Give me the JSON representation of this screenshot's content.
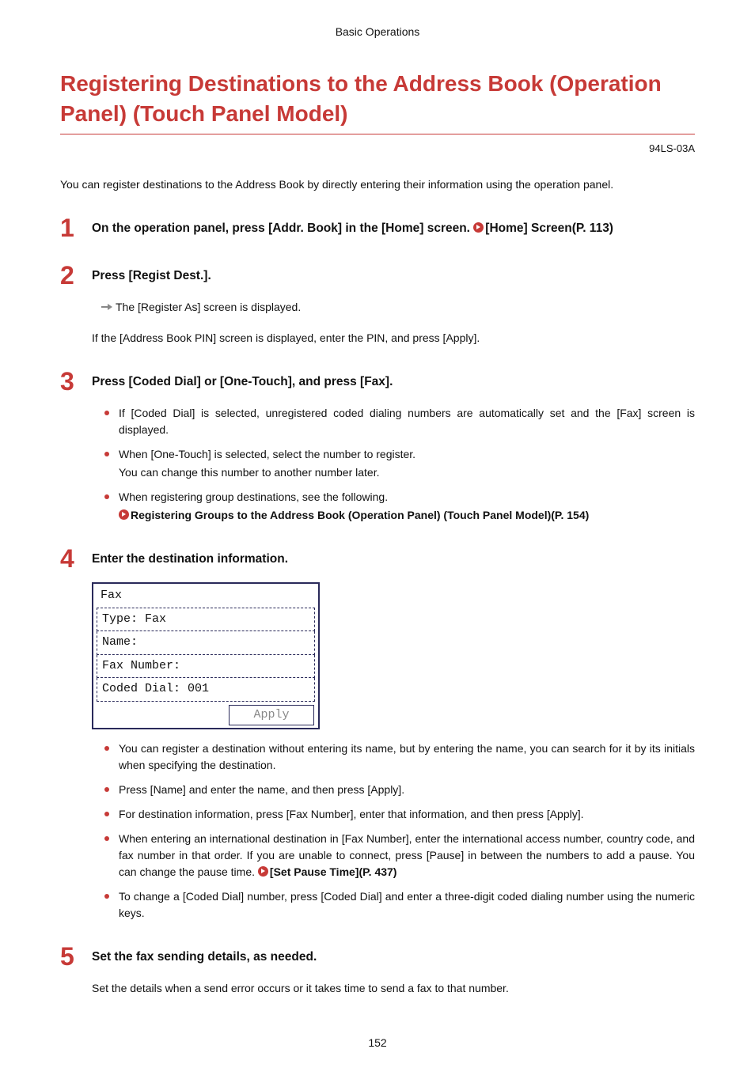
{
  "header": {
    "section": "Basic Operations"
  },
  "title": "Registering Destinations to the Address Book (Operation Panel) (Touch Panel Model)",
  "doc_code": "94LS-03A",
  "intro": "You can register destinations to the Address Book by directly entering their information using the operation panel.",
  "steps": {
    "s1": {
      "num": "1",
      "title_a": "On the operation panel, press [Addr. Book] in the [Home] screen. ",
      "link": "[Home] Screen(P. 113)"
    },
    "s2": {
      "num": "2",
      "title": "Press [Regist Dest.].",
      "result": "The [Register As] screen is displayed.",
      "note": "If the [Address Book PIN] screen is displayed, enter the PIN, and press [Apply]."
    },
    "s3": {
      "num": "3",
      "title": "Press [Coded Dial] or [One-Touch], and press [Fax].",
      "b1": "If [Coded Dial] is selected, unregistered coded dialing numbers are automatically set and the [Fax] screen is displayed.",
      "b2a": "When [One-Touch] is selected, select the number to register.",
      "b2b": "You can change this number to another number later.",
      "b3a": "When registering group destinations, see the following.",
      "b3link": "Registering Groups to the Address Book (Operation Panel) (Touch Panel Model)(P. 154)"
    },
    "s4": {
      "num": "4",
      "title": "Enter the destination information.",
      "screen": {
        "title": "Fax",
        "row1": "Type: Fax",
        "row2": "Name:",
        "row3": "Fax Number:",
        "row4": "Coded Dial: 001",
        "apply": "Apply"
      },
      "b1": "You can register a destination without entering its name, but by entering the name, you can search for it by its initials when specifying the destination.",
      "b2": "Press [Name] and enter the name, and then press [Apply].",
      "b3": "For destination information, press [Fax Number], enter that information, and then press [Apply].",
      "b4a": "When entering an international destination in [Fax Number], enter the international access number, country code, and fax number in that order. If you are unable to connect, press [Pause] in between the numbers to add a pause. You can change the pause time. ",
      "b4link": "[Set Pause Time](P. 437)",
      "b5": "To change a [Coded Dial] number, press [Coded Dial] and enter a three-digit coded dialing number using the numeric keys."
    },
    "s5": {
      "num": "5",
      "title": "Set the fax sending details, as needed.",
      "p": "Set the details when a send error occurs or it takes time to send a fax to that number."
    }
  },
  "page_number": "152"
}
